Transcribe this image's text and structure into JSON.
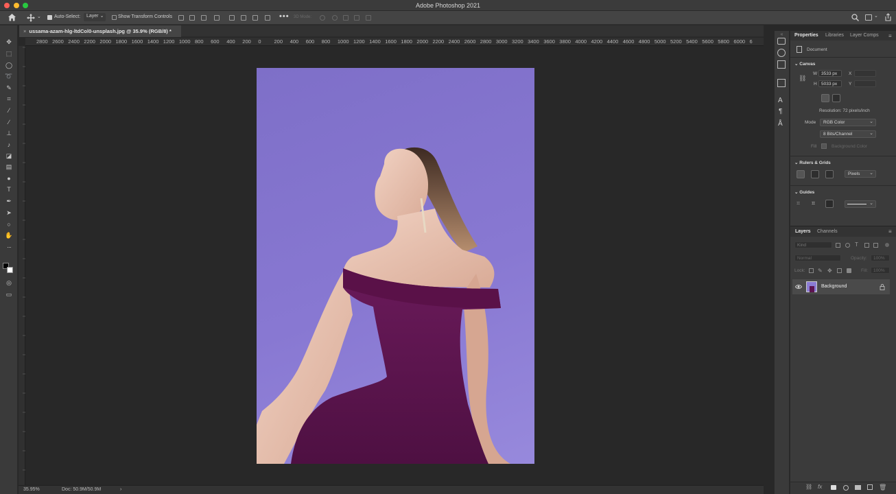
{
  "window": {
    "title": "Adobe Photoshop 2021"
  },
  "options_bar": {
    "auto_select_label": "Auto-Select:",
    "auto_select_value": "Layer",
    "show_transform_label": "Show Transform Controls",
    "three_d_mode_label": "3D Mode:"
  },
  "document": {
    "tab_label": "ussama-azam-hlg-ltdCol0-unsplash.jpg @ 35.9% (RGB/8) *"
  },
  "ruler": {
    "h_labels": [
      "2800",
      "2600",
      "2400",
      "2200",
      "2000",
      "1800",
      "1600",
      "1400",
      "1200",
      "1000",
      "800",
      "600",
      "400",
      "200",
      "0",
      "200",
      "400",
      "600",
      "800",
      "1000",
      "1200",
      "1400",
      "1600",
      "1800",
      "2000",
      "2200",
      "2400",
      "2600",
      "2800",
      "3000",
      "3200",
      "3400",
      "3600",
      "3800",
      "4000",
      "4200",
      "4400",
      "4600",
      "4800",
      "5000",
      "5200",
      "5400",
      "5600",
      "5800",
      "6000",
      "6"
    ]
  },
  "status": {
    "zoom": "35.95%",
    "doc_info": "Doc: 50.9M/50.9M",
    "arrow": "›"
  },
  "properties_panel": {
    "tabs": [
      "Properties",
      "Libraries",
      "Layer Comps"
    ],
    "doc_label": "Document",
    "canvas_section": "Canvas",
    "width_label": "W",
    "width_value": "3533 px",
    "height_label": "H",
    "height_value": "5033 px",
    "x_label": "X",
    "y_label": "Y",
    "resolution": "Resolution: 72 pixels/inch",
    "mode_label": "Mode",
    "mode_value": "RGB Color",
    "bits_value": "8 Bits/Channel",
    "fill_label": "Fill",
    "fill_value": "Background Color",
    "rulers_section": "Rulers & Grids",
    "units_value": "Pixels",
    "guides_section": "Guides"
  },
  "layers_panel": {
    "tabs": [
      "Layers",
      "Channels"
    ],
    "kind_placeholder": "Kind",
    "blend_mode": "Normal",
    "opacity_label": "Opacity:",
    "opacity_value": "100%",
    "lock_label": "Lock:",
    "fill_label": "Fill:",
    "fill_value": "100%",
    "layer_name": "Background"
  },
  "colors": {
    "accent_purple_bg": "#8a7bd3",
    "dress": "#5e1450",
    "traffic_red": "#fe5f57",
    "traffic_yellow": "#febc2e",
    "traffic_green": "#28c840"
  }
}
